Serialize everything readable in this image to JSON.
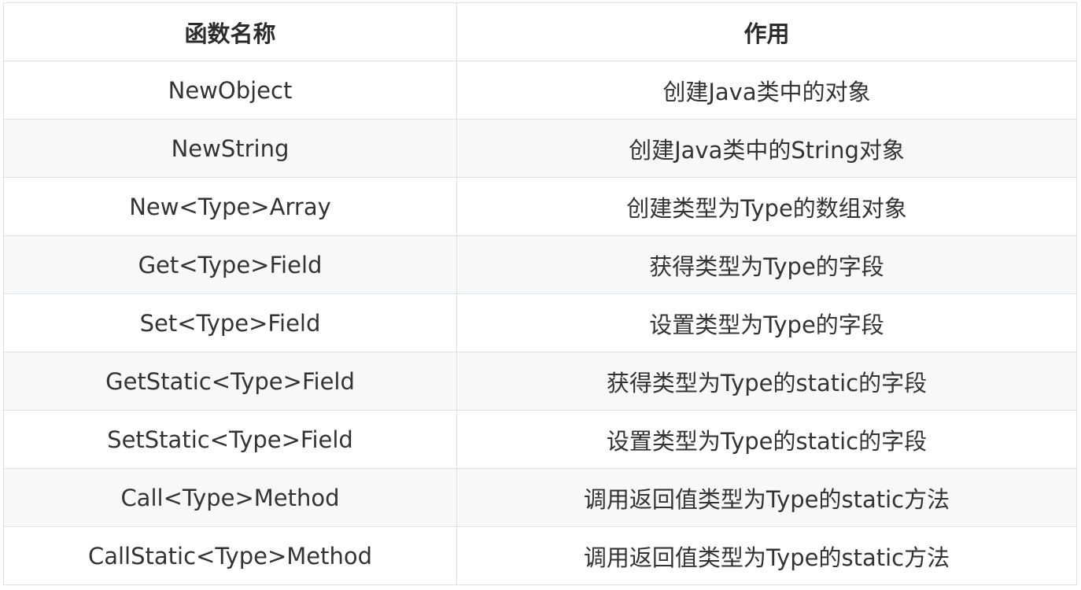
{
  "table": {
    "headers": [
      "函数名称",
      "作用"
    ],
    "rows": [
      {
        "name": "NewObject",
        "purpose": "创建Java类中的对象"
      },
      {
        "name": "NewString",
        "purpose": "创建Java类中的String对象"
      },
      {
        "name": "New<Type>Array",
        "purpose": "创建类型为Type的数组对象"
      },
      {
        "name": "Get<Type>Field",
        "purpose": "获得类型为Type的字段"
      },
      {
        "name": "Set<Type>Field",
        "purpose": "设置类型为Type的字段"
      },
      {
        "name": "GetStatic<Type>Field",
        "purpose": "获得类型为Type的static的字段"
      },
      {
        "name": "SetStatic<Type>Field",
        "purpose": "设置类型为Type的static的字段"
      },
      {
        "name": "Call<Type>Method",
        "purpose": "调用返回值类型为Type的static方法"
      },
      {
        "name": "CallStatic<Type>Method",
        "purpose": "调用返回值类型为Type的static方法"
      }
    ]
  },
  "colors": {
    "border": "#dfe2e5",
    "stripe": "#f6f8fa",
    "text": "#333333"
  }
}
